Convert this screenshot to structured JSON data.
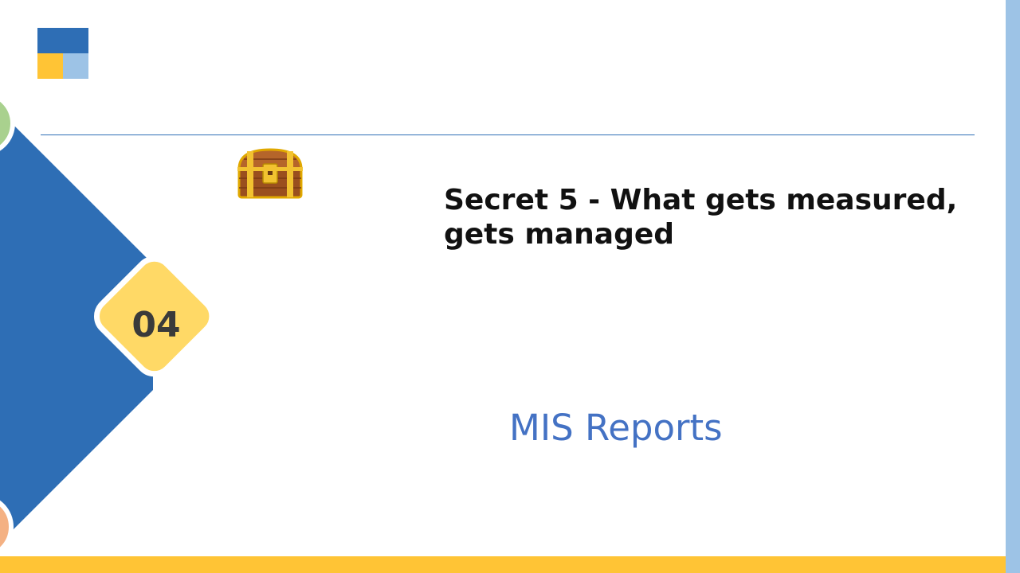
{
  "slide": {
    "section_number": "04",
    "heading": "Secret 5 - What gets measured, gets managed",
    "subtitle": "MIS Reports"
  },
  "colors": {
    "primary_blue": "#2e6eb5",
    "light_blue": "#9dc3e6",
    "yellow": "#ffc435",
    "number_tile": "#ffd966",
    "subtitle_text": "#4472c4",
    "green_accent": "#a9d18e",
    "orange_accent": "#f4b183"
  },
  "icons": {
    "logo": "three-square-logo-icon",
    "chest": "treasure-chest-icon"
  }
}
